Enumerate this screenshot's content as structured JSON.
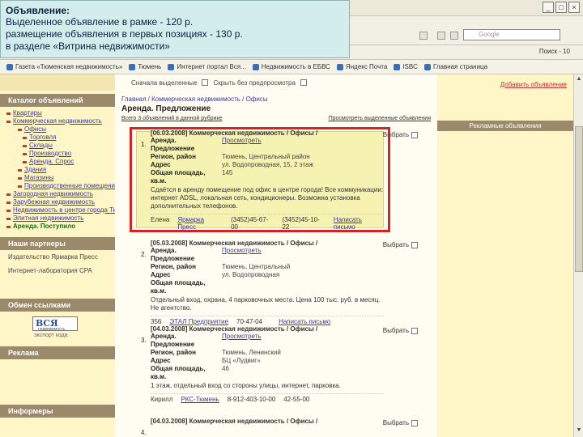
{
  "callout": {
    "title": "Объявление:",
    "lines": [
      "Выделенное объявление в рамке - 120 р.",
      "размещение объявления в первых позициях - 130 р.",
      "в разделе «Витрина недвижимости»"
    ]
  },
  "browser": {
    "search_placeholder": "Google",
    "toolbar_right": "Поиск - 10",
    "bookmarks": [
      "Газета «Тюменская недвижимость»",
      "Тюмень",
      "Интернет портал Вся...",
      "Недвижимость в ЕБВС",
      "Яндекс Почта",
      "ISBC",
      "Главная страница"
    ]
  },
  "left": {
    "catalog_title": "Каталог объявлений",
    "items": [
      {
        "label": "Квартиры",
        "level": 0
      },
      {
        "label": "Коммерческая недвижимость",
        "level": 0
      },
      {
        "label": "Офисы",
        "level": 1
      },
      {
        "label": "Торговля",
        "level": 2
      },
      {
        "label": "Склады",
        "level": 2
      },
      {
        "label": "Производство",
        "level": 2
      },
      {
        "label": "Аренда. Спрос",
        "level": 2
      },
      {
        "label": "Здания",
        "level": 1
      },
      {
        "label": "Магазины",
        "level": 1
      },
      {
        "label": "Производственные помещения",
        "level": 1
      },
      {
        "label": "Загородная недвижимость",
        "level": 0
      },
      {
        "label": "Зарубежная недвижимость",
        "level": 0
      },
      {
        "label": "Недвижимость в центре города Тюмени",
        "level": 0
      },
      {
        "label": "Элитная недвижимость",
        "level": 0
      },
      {
        "label": "Аренда. Поступило",
        "level": 0
      }
    ],
    "partners_title": "Наши партнеры",
    "partners": [
      "Издательство Ярмарка Пресс",
      "Интернет-лаборатория CPA"
    ],
    "exchange_title": "Обмен ссылками",
    "logo_text": "ВСЯ",
    "logo_sub": "недвижимость",
    "logo_caption": "экспорт кода",
    "ads_title": "Реклама",
    "informers_title": "Информеры"
  },
  "main": {
    "top_bar": "Сначала выделенные",
    "top_bar_2": "Скрыть без предпросмотра",
    "top_right": "Добавить объявление",
    "breadcrumbs": "Главная / Коммерческая недвижимость / Офисы",
    "title": "Аренда. Предложение",
    "sort_left": "Всего 3 объявлений в данной рубрике",
    "sort_right": "Просмотреть выделенные объявления",
    "ads": [
      {
        "num": "1.",
        "date_head": "[06.03.2008] Коммерческая недвижимость / Офисы /",
        "type": "Аренда. Предложение",
        "preview": "Просмотреть",
        "region_k": "Регион, район",
        "region_v": "Тюмень, Центральный район",
        "addr_k": "Адрес",
        "addr_v": "ул. Водопроводная, 15, 2 этаж",
        "area_k": "Общая площадь, кв.м.",
        "area_v": "145",
        "desc": "Сдаётся в аренду помещение под офис в центре города! Все коммуникации: интернет ADSL, локальная сеть, кондиционеры. Возможна установка дополнительных телефонов.",
        "contact": "Елена",
        "agency": "Ярмарка Пресс",
        "phone1": "(3452)45-67-00",
        "phone2": "(3452)45-10-22",
        "write": "Написать письмо",
        "choose": "Выбрать"
      },
      {
        "num": "2.",
        "date_head": "[05.03.2008] Коммерческая недвижимость / Офисы /",
        "type": "Аренда. Предложение",
        "preview": "Просмотреть",
        "region_k": "Регион, район",
        "region_v": "Тюмень, Центральный",
        "addr_k": "Адрес",
        "addr_v": "ул. Водопроводная",
        "area_k": "Общая площадь, кв.м.",
        "area_v": "",
        "desc": "Отдельный вход, охрана, 4 парковочных места. Цена 100 тыс. руб. в месяц. Не агентство.",
        "contact": "356",
        "agency": "ЭТАЛ Предприятие",
        "phone1": "70-47-04",
        "phone2": "",
        "write": "Написать письмо",
        "choose": "Выбрать"
      },
      {
        "num": "3.",
        "date_head": "[04.03.2008] Коммерческая недвижимость / Офисы /",
        "type": "Аренда. Предложение",
        "preview": "Просмотреть",
        "region_k": "Регион, район",
        "region_v": "Тюмень, Ленинский",
        "addr_k": "Адрес",
        "addr_v": "БЦ «Лудвиг»",
        "area_k": "Общая площадь, кв.м.",
        "area_v": "46",
        "desc": "1 этаж, отдельный вход со стороны улицы, интернет, парковка.",
        "contact": "Кирилл",
        "agency": "РКС-Тюмень",
        "phone1": "8-912-403-10-00",
        "phone2": "42-55-00",
        "write": "",
        "choose": "Выбрать"
      },
      {
        "num": "4.",
        "date_head": "[04.03.2008] Коммерческая недвижимость / Офисы /",
        "choose": "Выбрать"
      }
    ]
  },
  "right": {
    "head": "Рекламные объявления"
  }
}
